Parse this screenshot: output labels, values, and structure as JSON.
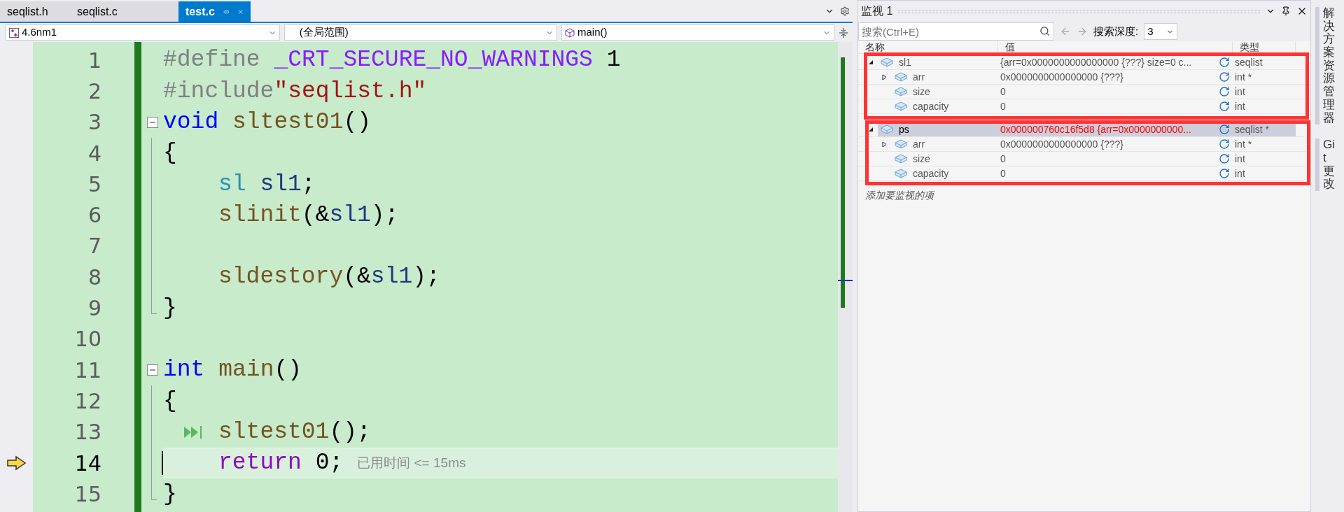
{
  "tabs": [
    {
      "label": "seqlist.h",
      "selected": false
    },
    {
      "label": "seqlist.c",
      "selected": false
    },
    {
      "label": "test.c",
      "selected": true
    }
  ],
  "nav": {
    "project": "4.6nm1",
    "scope": "(全局范围)",
    "member": "main()"
  },
  "code": [
    {
      "number": "1",
      "kind": "plain",
      "current": false,
      "run_to_click": false,
      "tokens": [
        {
          "text": "#define",
          "kind": "pre"
        },
        {
          "text": " _CRT_SECURE_NO_WARNINGS",
          "kind": "macro"
        },
        {
          "text": " 1",
          "kind": "plain"
        }
      ]
    },
    {
      "number": "2",
      "kind": "plain",
      "current": false,
      "run_to_click": false,
      "tokens": [
        {
          "text": "#include",
          "kind": "pre"
        },
        {
          "text": "\"seqlist.h\"",
          "kind": "str"
        }
      ]
    },
    {
      "number": "3",
      "kind": "fold-start",
      "current": false,
      "run_to_click": false,
      "tokens": [
        {
          "text": "void",
          "kind": "kw"
        },
        {
          "text": " sltest01",
          "kind": "fn"
        },
        {
          "text": "()",
          "kind": "plain"
        }
      ]
    },
    {
      "number": "4",
      "kind": "fold-body",
      "current": false,
      "run_to_click": false,
      "tokens": [
        {
          "text": "{",
          "kind": "plain"
        }
      ]
    },
    {
      "number": "5",
      "kind": "fold-body",
      "indented": true,
      "current": false,
      "run_to_click": false,
      "tokens": [
        {
          "text": "sl",
          "kind": "type"
        },
        {
          "text": " sl1",
          "kind": "var"
        },
        {
          "text": ";",
          "kind": "plain"
        }
      ]
    },
    {
      "number": "6",
      "kind": "fold-body",
      "indented": true,
      "current": false,
      "run_to_click": false,
      "tokens": [
        {
          "text": "slinit",
          "kind": "fn"
        },
        {
          "text": "(&",
          "kind": "plain"
        },
        {
          "text": "sl1",
          "kind": "var"
        },
        {
          "text": ");",
          "kind": "plain"
        }
      ]
    },
    {
      "number": "7",
      "kind": "fold-body",
      "current": false,
      "run_to_click": false
    },
    {
      "number": "8",
      "kind": "fold-body",
      "indented": true,
      "current": false,
      "run_to_click": false,
      "tokens": [
        {
          "text": "sldestory",
          "kind": "fn"
        },
        {
          "text": "(&",
          "kind": "plain"
        },
        {
          "text": "sl1",
          "kind": "var"
        },
        {
          "text": ");",
          "kind": "plain"
        }
      ]
    },
    {
      "number": "9",
      "kind": "fold-end",
      "current": false,
      "run_to_click": false,
      "tokens": [
        {
          "text": "}",
          "kind": "plain"
        }
      ]
    },
    {
      "number": "10",
      "kind": "plain",
      "current": false,
      "run_to_click": false
    },
    {
      "number": "11",
      "kind": "fold-start",
      "current": false,
      "run_to_click": false,
      "tokens": [
        {
          "text": "int",
          "kind": "kw"
        },
        {
          "text": " main",
          "kind": "fn"
        },
        {
          "text": "()",
          "kind": "plain"
        }
      ]
    },
    {
      "number": "12",
      "kind": "fold-body",
      "current": false,
      "run_to_click": false,
      "tokens": [
        {
          "text": "{",
          "kind": "plain"
        }
      ]
    },
    {
      "number": "13",
      "kind": "fold-body",
      "indented": true,
      "current": false,
      "run_to_click": true,
      "tokens": [
        {
          "text": "sltest01",
          "kind": "fn"
        },
        {
          "text": "();",
          "kind": "plain"
        }
      ]
    },
    {
      "number": "14",
      "kind": "fold-body",
      "indented": true,
      "current": true,
      "run_to_click": false,
      "tokens": [
        {
          "text": "return",
          "kind": "ctl"
        },
        {
          "text": " 0;",
          "kind": "plain"
        }
      ],
      "hint": "已用时间 <= 15ms"
    },
    {
      "number": "15",
      "kind": "fold-end",
      "current": false,
      "run_to_click": false,
      "tokens": [
        {
          "text": "}",
          "kind": "plain"
        }
      ]
    }
  ],
  "watch": {
    "title": "监视 1",
    "search": {
      "placeholder": "搜索(Ctrl+E)"
    },
    "depth_label": "搜索深度:",
    "depth": "3",
    "columns": [
      "名称",
      "值",
      "类型"
    ],
    "rows": [
      {
        "name": "sl1",
        "value": "{arr=0x0000000000000000 {???} size=0 c...",
        "type": "seqlist",
        "expanded": true,
        "selected": false,
        "changed": false,
        "children": [
          {
            "name": "arr",
            "value": "0x0000000000000000 {???}",
            "type": "int *",
            "expanded": false,
            "selected": false,
            "changed": false
          },
          {
            "name": "size",
            "value": "0",
            "type": "int",
            "selected": false,
            "changed": false
          },
          {
            "name": "capacity",
            "value": "0",
            "type": "int",
            "selected": false,
            "changed": false
          }
        ]
      },
      {
        "name": "ps",
        "value": "0x000000760c16f5d8 {arr=0x0000000000...",
        "type": "seqlist *",
        "expanded": true,
        "selected": true,
        "changed": true,
        "children": [
          {
            "name": "arr",
            "value": "0x0000000000000000 {???}",
            "type": "int *",
            "expanded": false,
            "selected": false,
            "changed": false
          },
          {
            "name": "size",
            "value": "0",
            "type": "int",
            "selected": false,
            "changed": false
          },
          {
            "name": "capacity",
            "value": "0",
            "type": "int",
            "selected": false,
            "changed": false
          }
        ]
      }
    ],
    "add_placeholder": "添加要监视的项"
  },
  "side_tabs": [
    "解决方案资源管理器",
    "Git 更改"
  ]
}
